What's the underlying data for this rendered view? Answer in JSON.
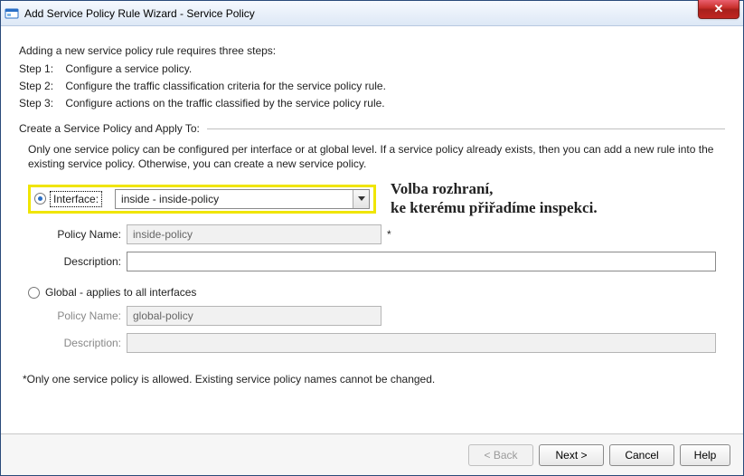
{
  "window": {
    "title": "Add Service Policy Rule Wizard - Service Policy",
    "close_glyph": "✕"
  },
  "intro": "Adding a new service policy rule requires three steps:",
  "steps": {
    "s1_label": "Step 1:",
    "s1_text": "Configure a service policy.",
    "s2_label": "Step 2:",
    "s2_text": "Configure the traffic classification criteria for the service policy rule.",
    "s3_label": "Step 3:",
    "s3_text": "Configure actions on the traffic classified by the service policy rule."
  },
  "group": {
    "label": "Create a Service Policy and Apply To:",
    "hint": "Only one service policy can be configured per interface or at global level. If a service policy already exists, then you can add a new rule into the existing service policy. Otherwise, you can create a new service policy."
  },
  "interface_option": {
    "label": "Interface:",
    "combo_value": "inside - inside-policy",
    "policy_name_label": "Policy Name:",
    "policy_name_value": "inside-policy",
    "asterisk": "*",
    "description_label": "Description:",
    "description_value": ""
  },
  "annotation": {
    "line1": "Volba rozhraní,",
    "line2": "ke kterému přiřadíme inspekci."
  },
  "global_option": {
    "label": "Global - applies to all interfaces",
    "policy_name_label": "Policy Name:",
    "policy_name_value": "global-policy",
    "description_label": "Description:",
    "description_value": ""
  },
  "footnote": "*Only one service policy is allowed. Existing service policy names cannot be changed.",
  "buttons": {
    "back": "< Back",
    "next": "Next >",
    "cancel": "Cancel",
    "help": "Help"
  }
}
